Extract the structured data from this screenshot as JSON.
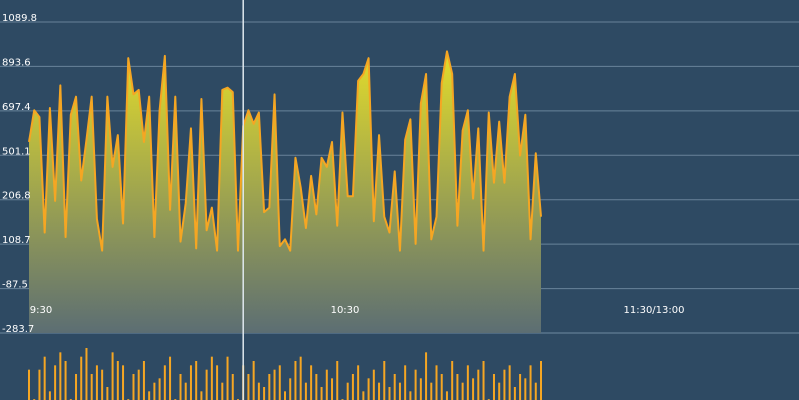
{
  "chart_data": {
    "type": "area",
    "title": "",
    "xlabel": "",
    "ylabel": "",
    "y_ticks": [
      "1089.8",
      "893.6",
      "697.4",
      "501.1",
      "206.8",
      "108.7",
      "-87.5",
      "-283.7"
    ],
    "x_ticks": [
      "9:30",
      "10:30",
      "11:30/13:00"
    ],
    "grid": true,
    "legend": "none",
    "crosshair_index": 41,
    "colors": {
      "background": "#2e4a63",
      "line": "#f5a623",
      "area_top": "#e3dc2a",
      "area_bottom": "#5c6e73",
      "grid": "#6f8aa0",
      "crosshair": "#dfe8ee",
      "volume": "#f5a623"
    },
    "series": [
      {
        "values": [
          560,
          700,
          670,
          160,
          710,
          300,
          810,
          140,
          680,
          760,
          390,
          570,
          760,
          220,
          80,
          760,
          450,
          590,
          200,
          930,
          770,
          790,
          560,
          760,
          140,
          700,
          940,
          260,
          760,
          120,
          290,
          620,
          90,
          750,
          170,
          270,
          80,
          790,
          800,
          780,
          80,
          630,
          700,
          640,
          690,
          250,
          270,
          770,
          100,
          130,
          80,
          490,
          360,
          180,
          410,
          240,
          490,
          450,
          560,
          190,
          690,
          320,
          320,
          830,
          860,
          930,
          210,
          590,
          230,
          160,
          430,
          80,
          570,
          660,
          110,
          730,
          860,
          130,
          230,
          820,
          960,
          860,
          190,
          610,
          700,
          310,
          620,
          80,
          690,
          380,
          650,
          380,
          760,
          860,
          500,
          680,
          130,
          510,
          230
        ]
      }
    ],
    "volume": {
      "values": [
        35,
        1,
        35,
        50,
        10,
        40,
        55,
        45,
        1,
        30,
        50,
        60,
        30,
        40,
        35,
        15,
        55,
        45,
        40,
        1,
        30,
        35,
        45,
        10,
        20,
        25,
        40,
        50,
        1,
        30,
        20,
        40,
        45,
        10,
        35,
        50,
        40,
        20,
        50,
        30,
        1,
        40,
        30,
        45,
        20,
        15,
        30,
        35,
        40,
        10,
        25,
        45,
        50,
        20,
        40,
        30,
        15,
        35,
        25,
        45,
        1,
        20,
        30,
        40,
        10,
        25,
        35,
        20,
        45,
        15,
        30,
        20,
        40,
        10,
        35,
        25,
        55,
        20,
        40,
        30,
        10,
        45,
        30,
        20,
        40,
        25,
        35,
        45,
        1,
        30,
        20,
        35,
        40,
        15,
        30,
        25,
        40,
        20,
        45
      ]
    }
  }
}
